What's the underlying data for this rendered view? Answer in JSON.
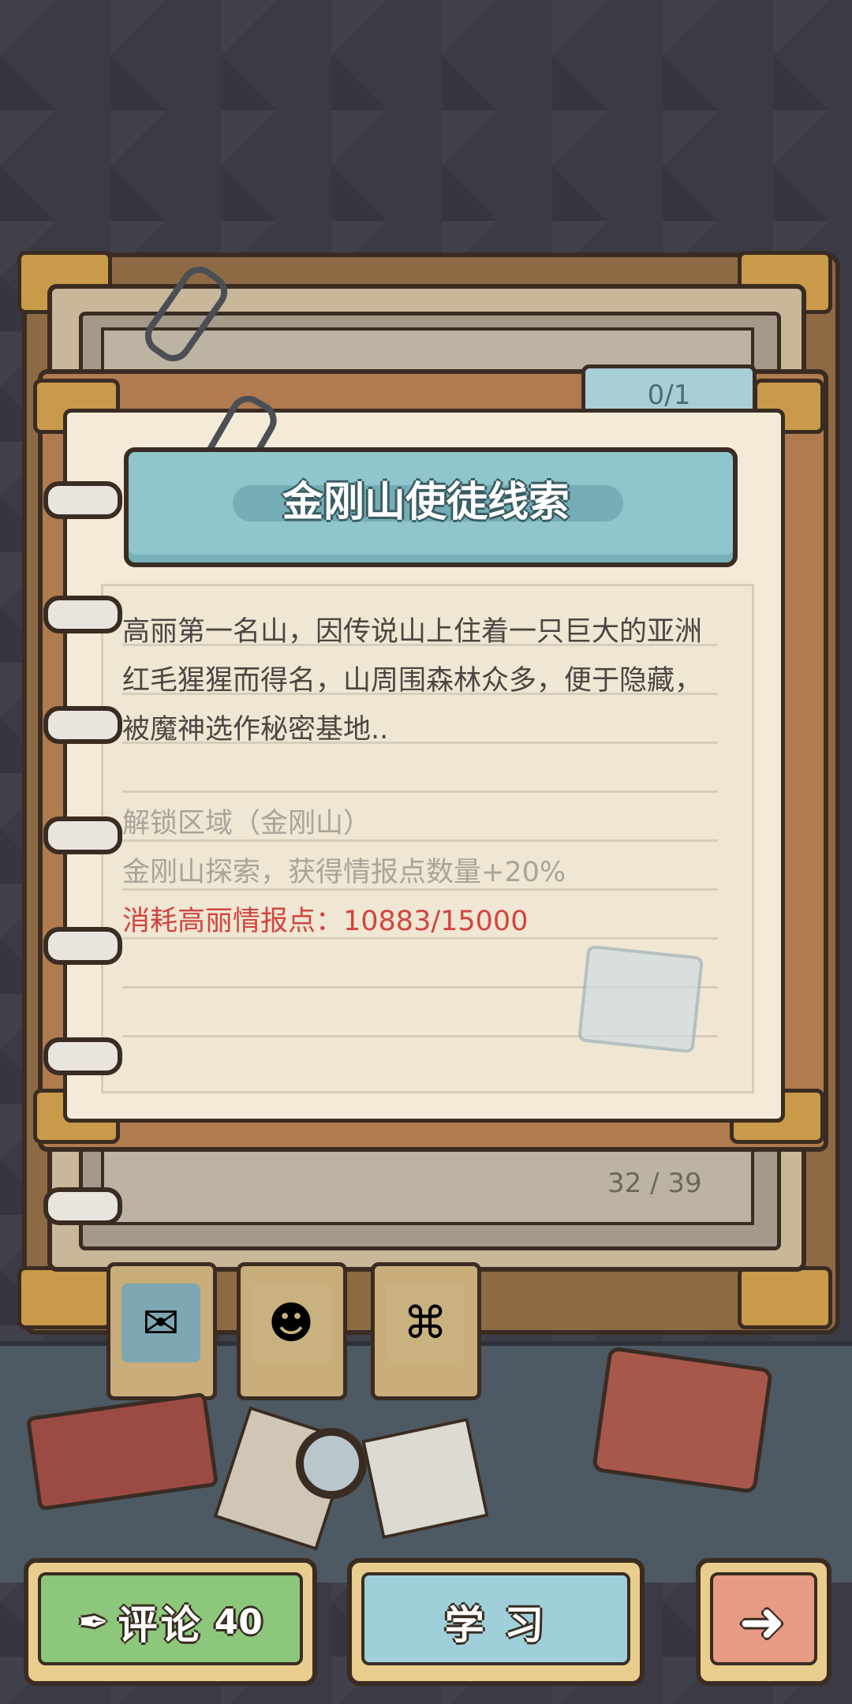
{
  "tab_counter": "0/1",
  "title": "金刚山使徒线索",
  "description": "高丽第一名山，因传说山上住着一只巨大的亚洲红毛猩猩而得名，山周围森林众多，便于隐藏，被魔神选作秘密基地..",
  "unlock_area": "解锁区域（金刚山）",
  "bonus": "金刚山探索，获得情报点数量+20%",
  "cost": "消耗高丽情报点：10883/15000",
  "page_number": "32 / 39",
  "buttons": {
    "comment_label": "评论",
    "comment_count": "40",
    "study_label": "学 习",
    "next_icon": "arrow-right-icon"
  },
  "colors": {
    "title_banner": "#8ec6cc",
    "cost_text": "#d2453f",
    "comment_button": "#8cc77c",
    "study_button": "#9fd0d9",
    "next_button": "#e79a84"
  }
}
